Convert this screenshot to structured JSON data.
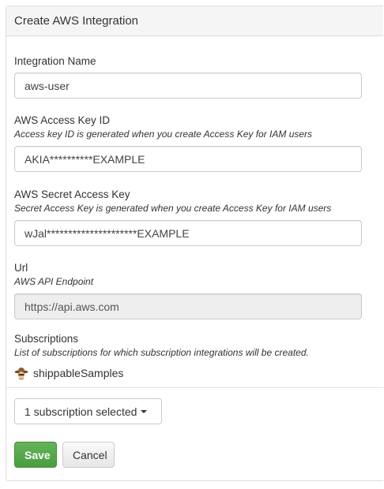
{
  "panel": {
    "title": "Create AWS Integration"
  },
  "form": {
    "name": {
      "label": "Integration Name",
      "value": "aws-user"
    },
    "access_key": {
      "label": "AWS Access Key ID",
      "help": "Access key ID is generated when you create Access Key for IAM users",
      "value": "AKIA**********EXAMPLE"
    },
    "secret_key": {
      "label": "AWS Secret Access Key",
      "help": "Secret Access Key is generated when you create Access Key for IAM users",
      "value": "wJal*********************EXAMPLE"
    },
    "url": {
      "label": "Url",
      "help": "AWS API Endpoint",
      "value": "https://api.aws.com"
    },
    "subscriptions": {
      "label": "Subscriptions",
      "help": "List of subscriptions for which subscription integrations will be created.",
      "items": [
        {
          "name": "shippableSamples",
          "icon": "cowboy-avatar-icon"
        }
      ],
      "dropdown_label": "1 subscription selected"
    }
  },
  "actions": {
    "save_label": "Save",
    "cancel_label": "Cancel"
  },
  "colors": {
    "save_button": "#5cb85c",
    "heading_bg": "#f5f5f5",
    "readonly_bg": "#eeeeee"
  }
}
